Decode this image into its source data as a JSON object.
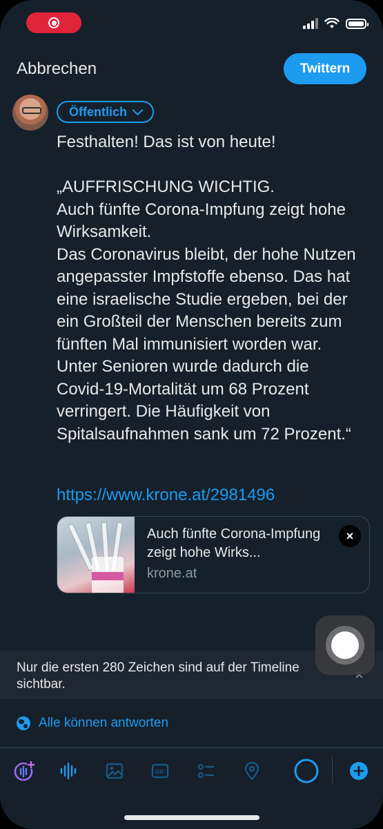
{
  "header": {
    "cancel_label": "Abbrechen",
    "tweet_label": "Twittern"
  },
  "compose": {
    "audience_label": "Öffentlich",
    "text": "Festhalten! Das ist von heute!\n\n„AUFFRISCHUNG WICHTIG.\nAuch fünfte Corona-Impfung zeigt hohe Wirksamkeit.\nDas Coronavirus bleibt, der hohe Nutzen angepasster Impfstoffe ebenso. Das hat eine israelische Studie ergeben, bei der ein Großteil der Menschen bereits zum fünften Mal immunisiert worden war. Unter Senioren wurde dadurch die Covid-19-Mortalität um 68 Prozent verringert. Die Häufigkeit von Spitalsaufnahmen sank um 72 Prozent.“",
    "link": "https://www.krone.at/2981496"
  },
  "card": {
    "title": "Auch fünfte Corona-Impfung zeigt hohe Wirks...",
    "domain": "krone.at",
    "close_icon": "×"
  },
  "notice": {
    "text": "Nur die ersten 280 Zeichen sind auf der Timeline sichtbar.",
    "close_icon": "×"
  },
  "reply_setting": {
    "label": "Alle können antworten"
  },
  "toolbar": {
    "items": [
      "add-space-icon",
      "voice-icon",
      "image-icon",
      "gif-icon",
      "poll-icon",
      "location-icon",
      "char-progress-ring",
      "add-tweet-icon"
    ]
  },
  "colors": {
    "background": "#15202b",
    "accent": "#1d9bf0",
    "text": "#e7e9ea",
    "muted": "#8b98a5",
    "record": "#e0243a"
  }
}
